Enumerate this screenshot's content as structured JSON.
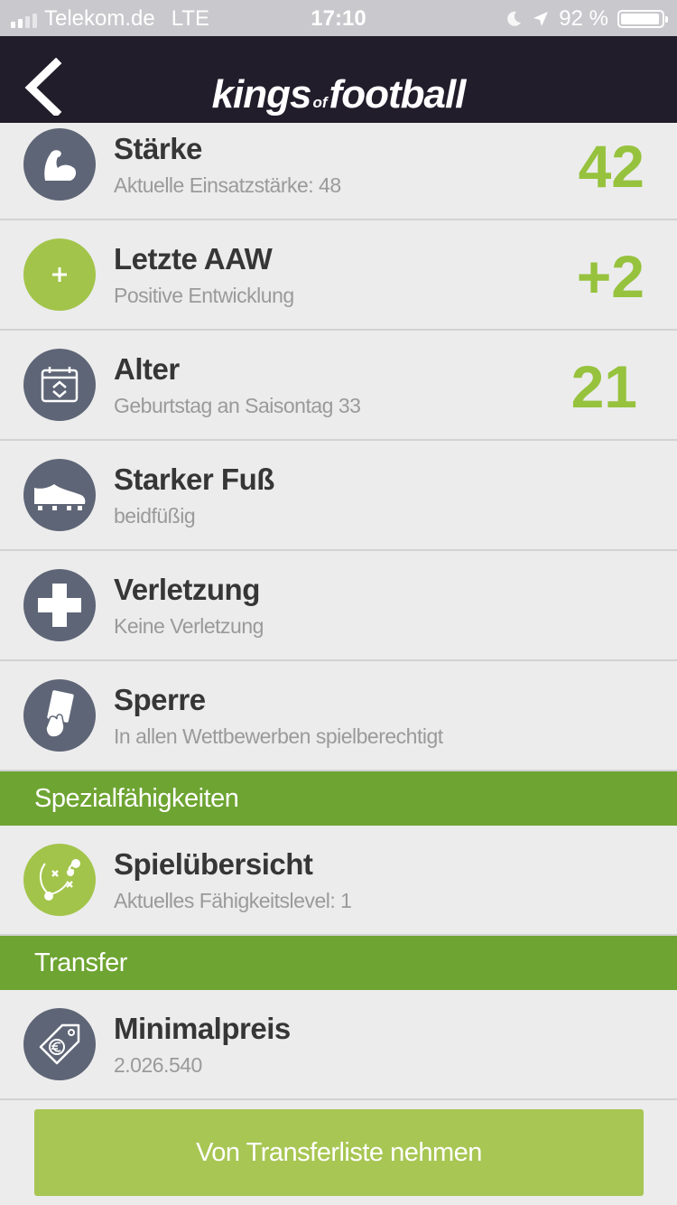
{
  "status_bar": {
    "carrier": "Telekom.de",
    "network": "LTE",
    "time": "17:10",
    "battery_percent": "92 %"
  },
  "header": {
    "logo_part1": "kings",
    "logo_part2": "of",
    "logo_part3": "football"
  },
  "rows": [
    {
      "title": "Stärke",
      "subtitle": "Aktuelle Einsatzstärke: 48",
      "value": "42",
      "icon": "flexed-arm-icon"
    },
    {
      "title": "Letzte AAW",
      "subtitle": "Positive Entwicklung",
      "value": "+2",
      "icon": "plus-circle-icon"
    },
    {
      "title": "Alter",
      "subtitle": "Geburtstag an Saisontag 33",
      "value": "21",
      "icon": "calendar-icon"
    },
    {
      "title": "Starker Fuß",
      "subtitle": "beidfüßig",
      "icon": "football-boot-icon"
    },
    {
      "title": "Verletzung",
      "subtitle": "Keine Verletzung",
      "icon": "medical-cross-icon"
    },
    {
      "title": "Sperre",
      "subtitle": "In allen Wettbewerben spielberechtigt",
      "icon": "referee-card-icon"
    }
  ],
  "special_section": {
    "label": "Spezialfähigkeiten",
    "item": {
      "title": "Spielübersicht",
      "subtitle": "Aktuelles Fähigkeitslevel: 1",
      "icon": "tactics-board-icon"
    }
  },
  "transfer_section": {
    "label": "Transfer",
    "item": {
      "title": "Minimalpreis",
      "subtitle": "2.026.540",
      "icon": "euro-price-tag-icon"
    }
  },
  "action_button": {
    "label": "Von Transferliste nehmen"
  },
  "colors": {
    "accent_green": "#96c23d",
    "section_green": "#6ea432",
    "navbar": "#221d2b",
    "icon_gray": "#5e6576"
  }
}
